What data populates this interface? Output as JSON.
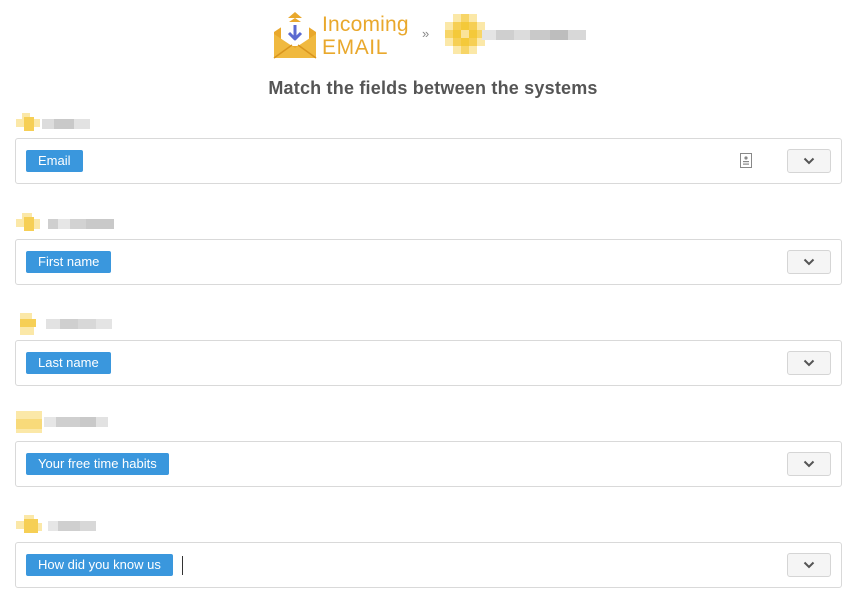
{
  "header": {
    "source_name_line1": "Incoming",
    "source_name_line2": "EMAIL",
    "separator": "»",
    "target_logo_icon": "blurred-logo-icon",
    "target_name": ""
  },
  "page_title": "Match the fields between the systems",
  "colors": {
    "brand_orange": "#e9a82c",
    "tag_blue": "#3a97dd",
    "arrow_purple": "#5b6ad0"
  },
  "fields": [
    {
      "label": "",
      "value": "Email",
      "has_doc_icon": true
    },
    {
      "label": "",
      "value": "First name"
    },
    {
      "label": "",
      "value": "Last name"
    },
    {
      "label": "",
      "value": "Your free time habits"
    },
    {
      "label": "",
      "value": "How did you know us",
      "focused": true
    }
  ]
}
